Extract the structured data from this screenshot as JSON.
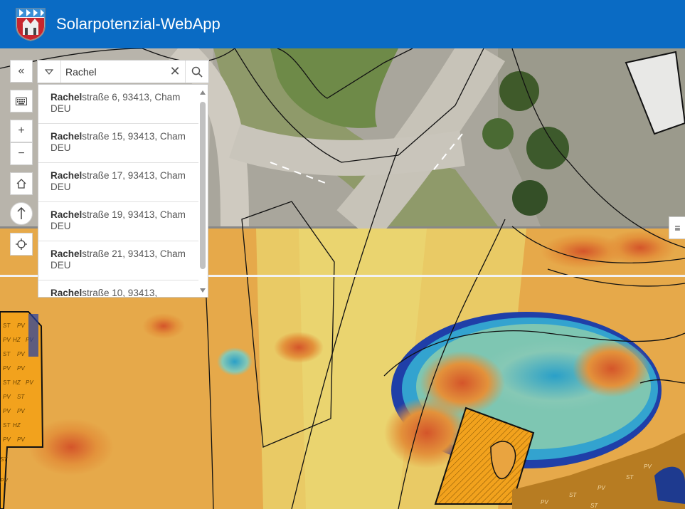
{
  "app": {
    "title": "Solarpotenzial-WebApp"
  },
  "toolbar": {
    "collapse_label": "«",
    "keyboard_icon": "keyboard-icon",
    "zoom_in_label": "+",
    "zoom_out_label": "−",
    "home_icon": "home-icon",
    "compass_icon": "compass-icon",
    "locate_icon": "locate-icon"
  },
  "search": {
    "value": "Rachel",
    "clear_label": "✕"
  },
  "suggestions": [
    {
      "match": "Rachel",
      "rest": "straße 6, 93413, Cham DEU"
    },
    {
      "match": "Rachel",
      "rest": "straße 15, 93413, Cham DEU"
    },
    {
      "match": "Rachel",
      "rest": "straße 17, 93413, Cham DEU"
    },
    {
      "match": "Rachel",
      "rest": "straße 19, 93413, Cham DEU"
    },
    {
      "match": "Rachel",
      "rest": "straße 21, 93413, Cham DEU"
    },
    {
      "match": "Rachel",
      "rest": "straße 10, 93413,"
    }
  ],
  "map": {
    "hatch_labels": [
      "PV",
      "ST",
      "HZ"
    ],
    "layer_list_icon": "layer-list-icon"
  },
  "colors": {
    "header": "#0a6bc4",
    "solar_high": "#e8a63a",
    "solar_low": "#1f3fa8",
    "parcel_line": "#111111"
  }
}
